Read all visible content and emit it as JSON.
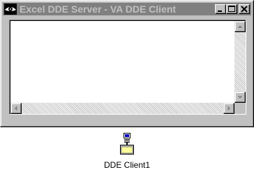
{
  "window": {
    "title": "Excel DDE Server - VA DDE Client",
    "icons": {
      "app": "eye-icon",
      "minimize": "minimize-icon",
      "maximize": "maximize-icon",
      "close": "close-icon"
    },
    "colors": {
      "titlebar_inactive": "#808080",
      "title_text": "#c0c0c0",
      "face": "#c0c0c0",
      "client": "#ffffff"
    }
  },
  "scrollbars": {
    "icons": {
      "up": "arrow-up-icon",
      "down": "arrow-down-icon",
      "left": "arrow-left-icon",
      "right": "arrow-right-icon"
    }
  },
  "desktop_icon": {
    "label": "DDE Client1",
    "icon": "dde-client-icon"
  }
}
